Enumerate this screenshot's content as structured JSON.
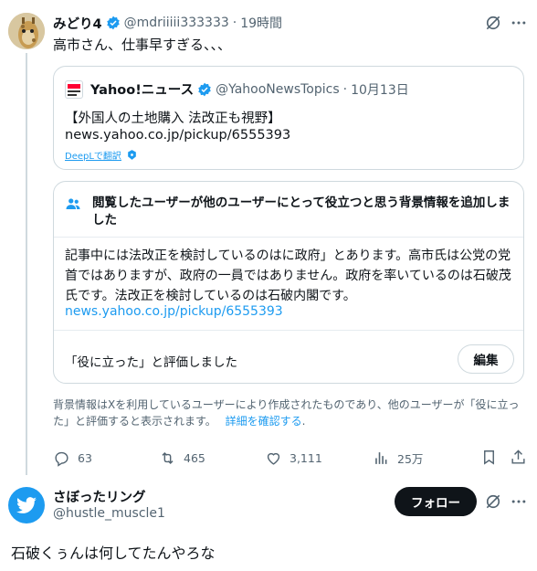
{
  "tweet1": {
    "display_name": "みどり4",
    "handle": "@mdriiiii333333",
    "separator": "·",
    "time": "19時間",
    "text": "高市さん、仕事早すぎる、、、"
  },
  "quote": {
    "source_name": "Yahoo!ニュース",
    "source_handle": "@YahooNewsTopics",
    "separator": "·",
    "date": "10月13日",
    "text": "【外国人の土地購入 法改正も視野】",
    "url": "news.yahoo.co.jp/pickup/6555393",
    "translate_label": "DeepLで翻訳"
  },
  "note": {
    "header": "閲覧したユーザーが他のユーザーにとって役立つと思う背景情報を追加しました",
    "body": "記事中には法改正を検討しているのはに政府」とあります。高市氏は公党の党首ではありますが、政府の一員ではありません。政府を率いているのは石破茂氏です。法改正を検討しているのは石破内閣です。",
    "url": "news.yahoo.co.jp/pickup/6555393",
    "rated_label": "「役に立った」と評価しました",
    "edit_label": "編集",
    "disclaimer": "背景情報はXを利用しているユーザーにより作成されたものであり、他のユーザーが「役に立った」と評価すると表示されます。",
    "learn_more": "詳細を確認する"
  },
  "actions": {
    "replies": "63",
    "retweets": "465",
    "likes": "3,111",
    "views": "25万"
  },
  "tweet2": {
    "display_name": "さぼったリング",
    "handle": "@hustle_muscle1",
    "follow_label": "フォロー",
    "text": "石破くぅんは何してたんやろな"
  },
  "colors": {
    "accent": "#1d9bf0",
    "text": "#0f1419",
    "muted": "#536471",
    "border": "#cfd9de"
  }
}
